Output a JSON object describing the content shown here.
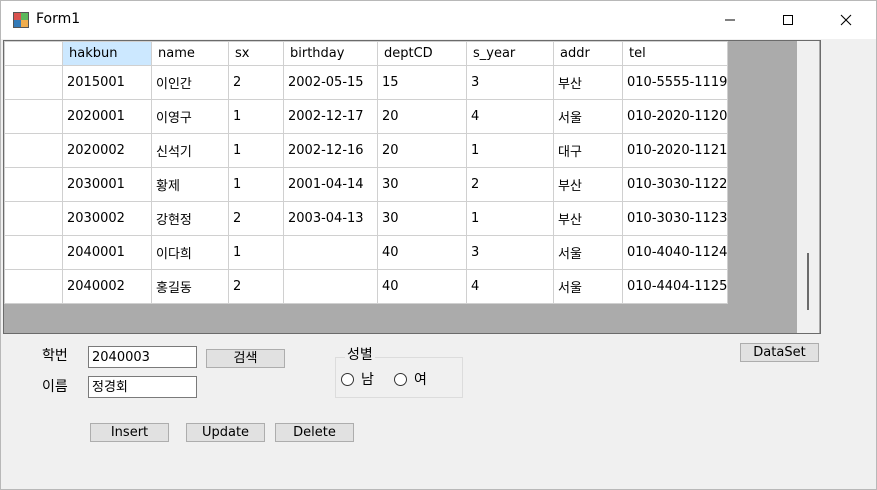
{
  "window": {
    "title": "Form1"
  },
  "grid": {
    "columns": [
      "hakbun",
      "name",
      "sx",
      "birthday",
      "deptCD",
      "s_year",
      "addr",
      "tel"
    ],
    "rows": [
      [
        "2015001",
        "이인간",
        "2",
        "2002-05-15",
        "15",
        "3",
        "부산",
        "010-5555-1119"
      ],
      [
        "2020001",
        "이영구",
        "1",
        "2002-12-17",
        "20",
        "4",
        "서울",
        "010-2020-1120"
      ],
      [
        "2020002",
        "신석기",
        "1",
        "2002-12-16",
        "20",
        "1",
        "대구",
        "010-2020-1121"
      ],
      [
        "2030001",
        "황제",
        "1",
        "2001-04-14",
        "30",
        "2",
        "부산",
        "010-3030-1122"
      ],
      [
        "2030002",
        "강현정",
        "2",
        "2003-04-13",
        "30",
        "1",
        "부산",
        "010-3030-1123"
      ],
      [
        "2040001",
        "이다희",
        "1",
        "",
        "40",
        "3",
        "서울",
        "010-4040-1124"
      ],
      [
        "2040002",
        "홍길동",
        "2",
        "",
        "40",
        "4",
        "서울",
        "010-4404-1125"
      ]
    ]
  },
  "form": {
    "hakbun_label": "학번",
    "hakbun_value": "2040003",
    "name_label": "이름",
    "name_value": "정경회",
    "search_button": "검색",
    "gender_group": "성별",
    "male_label": "남",
    "female_label": "여",
    "dataset_button": "DataSet",
    "insert_button": "Insert",
    "update_button": "Update",
    "delete_button": "Delete"
  },
  "colors": {
    "header_selected": "#cce8ff",
    "grid_background": "#ababab"
  }
}
